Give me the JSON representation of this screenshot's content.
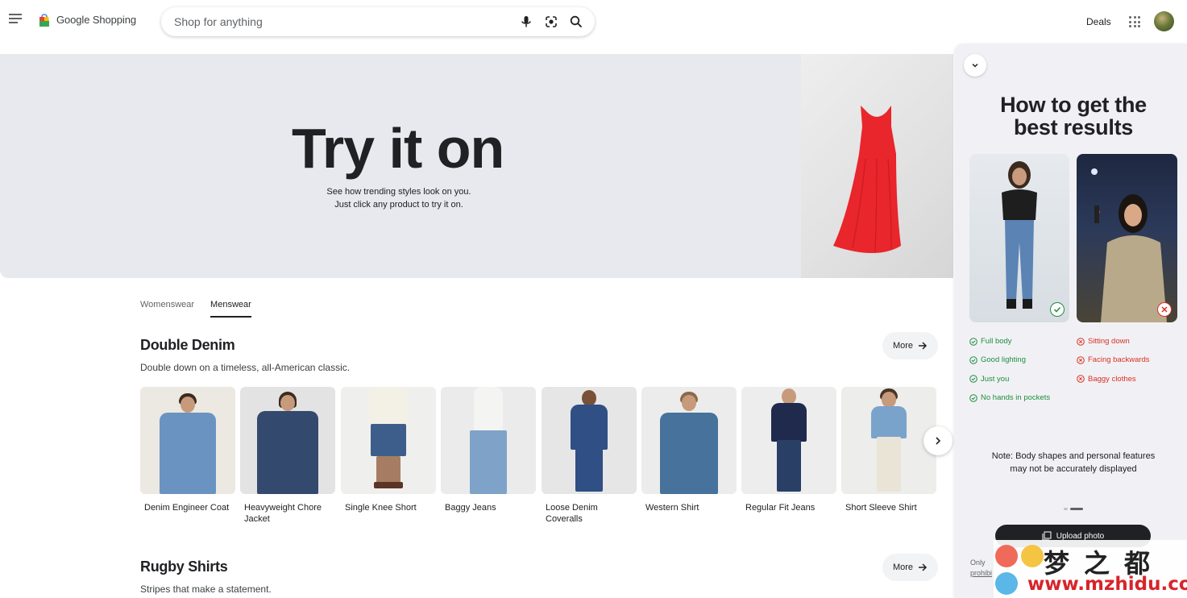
{
  "header": {
    "logo_text": "Google Shopping",
    "search_placeholder": "Shop for anything",
    "deals_label": "Deals"
  },
  "hero": {
    "title": "Try it on",
    "subtitle_line1": "See how trending styles look on you.",
    "subtitle_line2": "Just click any product to try it on."
  },
  "tabs": [
    {
      "label": "Womenswear",
      "active": false
    },
    {
      "label": "Menswear",
      "active": true
    }
  ],
  "sections": [
    {
      "title": "Double Denim",
      "subtitle": "Double down on a timeless, all-American classic.",
      "more_label": "More",
      "products": [
        {
          "line1": "Denim Engineer Coat",
          "line2": ""
        },
        {
          "line1": "Heavyweight Chore",
          "line2": "Jacket"
        },
        {
          "line1": "Single Knee Short",
          "line2": ""
        },
        {
          "line1": "Baggy Jeans",
          "line2": ""
        },
        {
          "line1": "Loose Denim",
          "line2": "Coveralls"
        },
        {
          "line1": "Western Shirt",
          "line2": ""
        },
        {
          "line1": "Regular Fit Jeans",
          "line2": ""
        },
        {
          "line1": "Short Sleeve Shirt",
          "line2": ""
        }
      ]
    },
    {
      "title": "Rugby Shirts",
      "subtitle": "Stripes that make a statement.",
      "more_label": "More"
    }
  ],
  "panel": {
    "title_line1": "How to get the",
    "title_line2": "best results",
    "good_tips": [
      "Full body",
      "Good lighting",
      "Just you",
      "No hands in pockets"
    ],
    "bad_tips": [
      "Sitting down",
      "Facing backwards",
      "Baggy clothes"
    ],
    "note_line1": "Note: Body shapes and personal features",
    "note_line2": "may not be accurately displayed",
    "upload_label": "Upload photo",
    "disclaimer_line1": "Only",
    "disclaimer_line2": "prohibi"
  },
  "watermark": {
    "chinese": "梦之都",
    "url": "www.mzhidu.com"
  },
  "colors": {
    "good": "#1e8e3e",
    "bad": "#d93025",
    "hero_bg": "#e8e9ee",
    "dress": "#e8262c"
  }
}
